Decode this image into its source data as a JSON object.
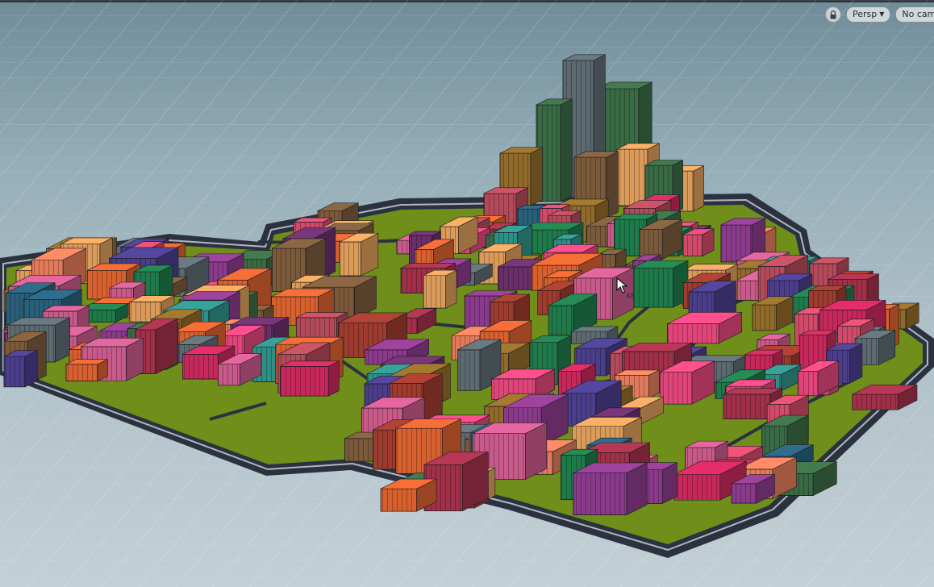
{
  "viewport": {
    "camera_mode": "Persp",
    "camera_name": "No cam",
    "lock_icon": "lock-icon",
    "cursor_label": "xz"
  },
  "colors": {
    "ground": "#6f8f1a",
    "road": "#2c3140",
    "curb": "#aeb7bd"
  }
}
